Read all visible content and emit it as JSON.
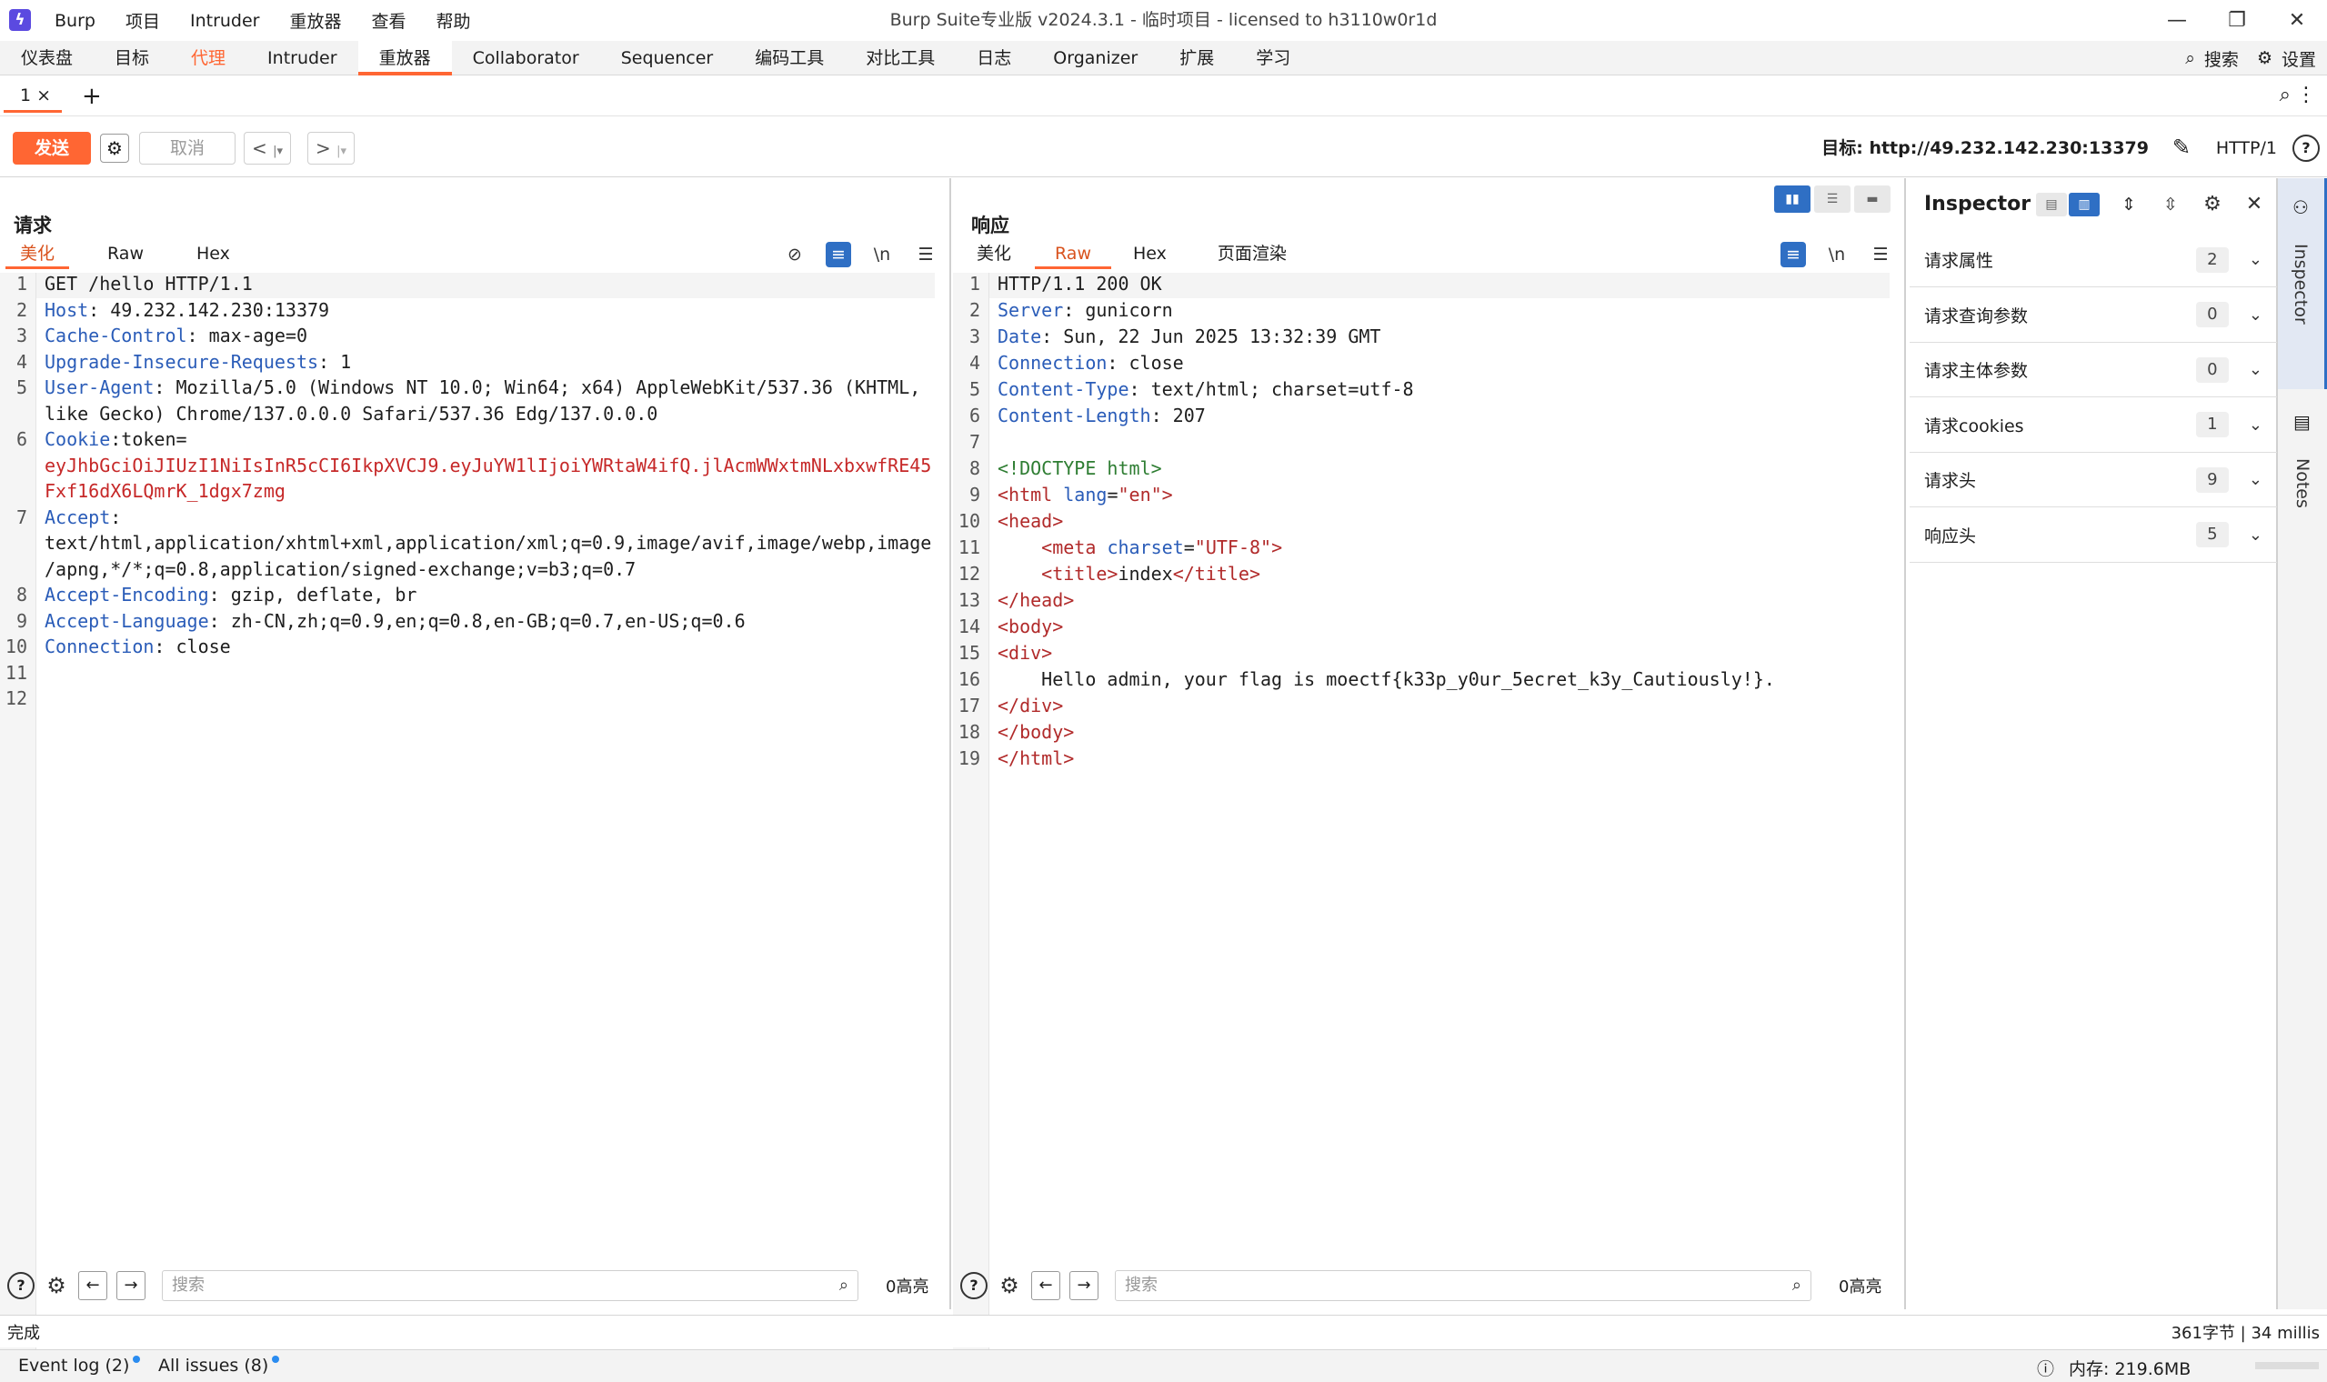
{
  "titlebar": {
    "menu": [
      "Burp",
      "项目",
      "Intruder",
      "重放器",
      "查看",
      "帮助"
    ],
    "title": "Burp Suite专业版  v2024.3.1 - 临时项目 - licensed to h3110w0r1d"
  },
  "main_tabs": [
    "仪表盘",
    "目标",
    "代理",
    "Intruder",
    "重放器",
    "Collaborator",
    "Sequencer",
    "编码工具",
    "对比工具",
    "日志",
    "Organizer",
    "扩展",
    "学习"
  ],
  "top_right": {
    "search": "搜索",
    "settings": "设置"
  },
  "subtabs": {
    "tab1": "1 ×",
    "add": "+"
  },
  "toolbar": {
    "send": "发送",
    "cancel": "取消",
    "target": "目标: http://49.232.142.230:13379",
    "http_version": "HTTP/1"
  },
  "request": {
    "title": "请求",
    "tabs": [
      "美化",
      "Raw",
      "Hex"
    ],
    "lines": [
      {
        "n": "1",
        "k": "",
        "v": "GET /hello HTTP/1.1"
      },
      {
        "n": "2",
        "k": "Host",
        "v": ": 49.232.142.230:13379"
      },
      {
        "n": "3",
        "k": "Cache-Control",
        "v": ": max-age=0"
      },
      {
        "n": "4",
        "k": "Upgrade-Insecure-Requests",
        "v": ": 1"
      },
      {
        "n": "5",
        "k": "User-Agent",
        "v": ": Mozilla/5.0 (Windows NT 10.0; Win64; x64) AppleWebKit/537.36 (KHTML,"
      },
      {
        "n": "",
        "k": "",
        "v": "like Gecko) Chrome/137.0.0.0 Safari/537.36 Edg/137.0.0.0"
      },
      {
        "n": "6",
        "k": "Cookie",
        "v": ":token="
      },
      {
        "n": "",
        "k": "",
        "v": "eyJhbGciOiJIUzI1NiIsInR5cCI6IkpXVCJ9.eyJuYW1lIjoiYWRtaW4ifQ.jlAcmWWxtmNLxbxwfRE45",
        "red": true
      },
      {
        "n": "",
        "k": "",
        "v": "Fxf16dX6LQmrK_1dgx7zmg",
        "red": true
      },
      {
        "n": "7",
        "k": "Accept",
        "v": ":"
      },
      {
        "n": "",
        "k": "",
        "v": "text/html,application/xhtml+xml,application/xml;q=0.9,image/avif,image/webp,image"
      },
      {
        "n": "",
        "k": "",
        "v": "/apng,*/*;q=0.8,application/signed-exchange;v=b3;q=0.7"
      },
      {
        "n": "8",
        "k": "Accept-Encoding",
        "v": ": gzip, deflate, br"
      },
      {
        "n": "9",
        "k": "Accept-Language",
        "v": ": zh-CN,zh;q=0.9,en;q=0.8,en-GB;q=0.7,en-US;q=0.6"
      },
      {
        "n": "10",
        "k": "Connection",
        "v": ": close"
      },
      {
        "n": "11",
        "k": "",
        "v": ""
      },
      {
        "n": "12",
        "k": "",
        "v": ""
      }
    ],
    "search_placeholder": "搜索",
    "highlights": "0高亮"
  },
  "response": {
    "title": "响应",
    "tabs": [
      "美化",
      "Raw",
      "Hex",
      "页面渲染"
    ],
    "lines": [
      {
        "n": "1",
        "k": "",
        "v": "HTTP/1.1 200 OK"
      },
      {
        "n": "2",
        "k": "Server",
        "v": ": gunicorn"
      },
      {
        "n": "3",
        "k": "Date",
        "v": ": Sun, 22 Jun 2025 13:32:39 GMT"
      },
      {
        "n": "4",
        "k": "Connection",
        "v": ": close"
      },
      {
        "n": "5",
        "k": "Content-Type",
        "v": ": text/html; charset=utf-8"
      },
      {
        "n": "6",
        "k": "Content-Length",
        "v": ": 207"
      },
      {
        "n": "7",
        "k": "",
        "v": ""
      },
      {
        "n": "8",
        "html": "<span class=\"dt\">&lt;!DOCTYPE html&gt;</span>"
      },
      {
        "n": "9",
        "html": "<span class=\"tag\">&lt;html</span> <span class=\"attr\">lang</span>=<span class=\"str\">\"en\"</span><span class=\"tag\">&gt;</span>"
      },
      {
        "n": "10",
        "html": "<span class=\"tag\">&lt;head&gt;</span>"
      },
      {
        "n": "11",
        "html": "    <span class=\"tag\">&lt;meta</span> <span class=\"attr\">charset</span>=<span class=\"str\">\"UTF-8\"</span><span class=\"tag\">&gt;</span>"
      },
      {
        "n": "12",
        "html": "    <span class=\"tag\">&lt;title&gt;</span>index<span class=\"tag\">&lt;/title&gt;</span>"
      },
      {
        "n": "13",
        "html": "<span class=\"tag\">&lt;/head&gt;</span>"
      },
      {
        "n": "14",
        "html": "<span class=\"tag\">&lt;body&gt;</span>"
      },
      {
        "n": "15",
        "html": "<span class=\"tag\">&lt;div&gt;</span>"
      },
      {
        "n": "16",
        "html": "    Hello admin, your flag is moectf{k33p_y0ur_5ecret_k3y_Cautiously!}."
      },
      {
        "n": "17",
        "html": "<span class=\"tag\">&lt;/div&gt;</span>"
      },
      {
        "n": "18",
        "html": "<span class=\"tag\">&lt;/body&gt;</span>"
      },
      {
        "n": "19",
        "html": "<span class=\"tag\">&lt;/html&gt;</span>"
      }
    ],
    "search_placeholder": "搜索",
    "highlights": "0高亮"
  },
  "inspector": {
    "title": "Inspector",
    "rows": [
      {
        "label": "请求属性",
        "count": "2"
      },
      {
        "label": "请求查询参数",
        "count": "0"
      },
      {
        "label": "请求主体参数",
        "count": "0"
      },
      {
        "label": "请求cookies",
        "count": "1"
      },
      {
        "label": "请求头",
        "count": "9"
      },
      {
        "label": "响应头",
        "count": "5"
      }
    ]
  },
  "side_rail": {
    "inspector": "Inspector",
    "notes": "Notes"
  },
  "status": {
    "left": "完成",
    "right": "361字节 | 34 millis"
  },
  "bottom": {
    "event_log": "Event log (2)",
    "all_issues": "All issues (8)",
    "memory": "内存: 219.6MB"
  }
}
